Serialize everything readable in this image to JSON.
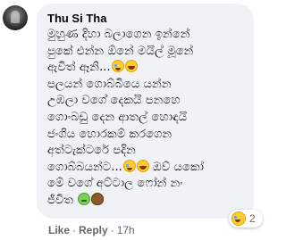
{
  "comment": {
    "author": "Thu Si Tha",
    "lines": [
      {
        "text": "මුහුණ දිහා බලාගෙන ඉන්නේ"
      },
      {
        "text": "පුකේ එන්න ඕනේ මයිල් මූනේ"
      },
      {
        "text": "ඇවිත් ඈනි...",
        "emojis": [
          "tears",
          "grin"
        ]
      },
      {
        "text": "පලයන් ගොබ්බියෙ යන්න"
      },
      {
        "text": "උඹලා වගේ දෙකයි පනහෙ"
      },
      {
        "text": "ගොංබඩු දෙන ආතල් හොඳයි"
      },
      {
        "text": "ජංගිය හොරකම් කරගෙන"
      },
      {
        "text": "අත්ටැක්ටරේ පදින"
      },
      {
        "text": "ගොබ්බයන්ට...",
        "emojis": [
          "tears",
          "grin"
        ],
        "after": " ඔව් යකෝ"
      },
      {
        "text": "මේ වගේ අට්ටාල ෆෝන් නං"
      },
      {
        "text": "ජීවිත",
        "emojis": [
          "sick",
          "poop"
        ]
      }
    ],
    "reaction": {
      "icon": "tears-of-joy-reaction-icon",
      "count": "2"
    },
    "actions": {
      "like": "Like",
      "reply": "Reply",
      "separator": "·",
      "time": "17h"
    }
  },
  "colors": {
    "bubble": "#f0f2f5",
    "text": "#050505",
    "meta": "#65676b",
    "reaction_face": "#ffcc33"
  }
}
